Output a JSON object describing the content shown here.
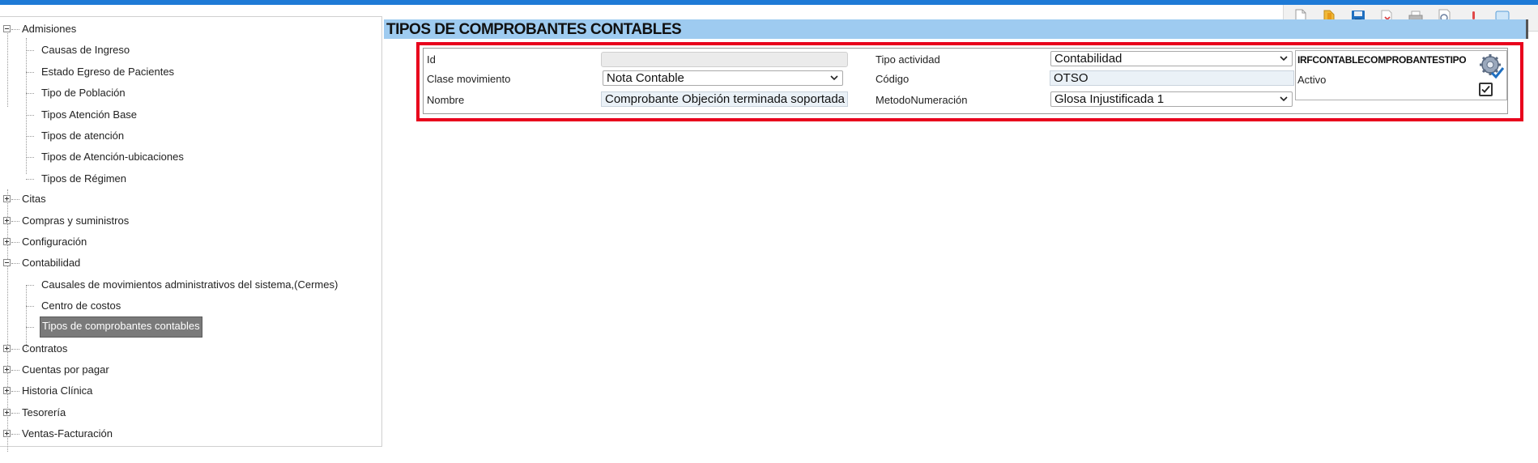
{
  "sidebar": {
    "groups": [
      {
        "label": "Admisiones",
        "expanded": true,
        "children": [
          "Causas de Ingreso",
          "Estado Egreso de Pacientes",
          "Tipo de Población",
          "Tipos Atención Base",
          "Tipos de atención",
          "Tipos de Atención-ubicaciones",
          "Tipos de Régimen"
        ]
      },
      {
        "label": "Citas",
        "expanded": false
      },
      {
        "label": "Compras y suministros",
        "expanded": false
      },
      {
        "label": "Configuración",
        "expanded": false
      },
      {
        "label": "Contabilidad",
        "expanded": true,
        "children": [
          "Causales de movimientos administrativos del sistema,(Cermes)",
          "Centro de costos",
          "Tipos de comprobantes contables"
        ],
        "selected": "Tipos de comprobantes contables"
      },
      {
        "label": "Contratos",
        "expanded": false
      },
      {
        "label": "Cuentas por pagar",
        "expanded": false
      },
      {
        "label": "Historia Clínica",
        "expanded": false
      },
      {
        "label": "Tesorería",
        "expanded": false
      },
      {
        "label": "Ventas-Facturación",
        "expanded": false
      }
    ]
  },
  "toolbar": {
    "buttons": [
      "new-document-icon",
      "open-folder-icon",
      "save-icon",
      "delete-icon",
      "print-icon",
      "print-preview-icon",
      "alert-icon",
      "comment-icon"
    ]
  },
  "page": {
    "title": "TIPOS DE COMPROBANTES CONTABLES"
  },
  "form": {
    "id": {
      "label": "Id",
      "value": ""
    },
    "clase_movimiento": {
      "label": "Clase movimiento",
      "value": "Nota Contable"
    },
    "nombre": {
      "label": "Nombre",
      "value": "Comprobante Objeción terminada soportada"
    },
    "tipo_actividad": {
      "label": "Tipo actividad",
      "value": "Contabilidad"
    },
    "codigo": {
      "label": "Código",
      "value": "OTSO"
    },
    "metodo_numeracion": {
      "label": "MetodoNumeración",
      "value": "Glosa Injustificada 1"
    },
    "component_name": "IRFCONTABLECOMPROBANTESTIPO",
    "activo": {
      "label": "Activo",
      "checked": true
    }
  },
  "colors": {
    "accent": "#1e7ad6",
    "title_bar": "#9ecbf0",
    "highlight": "#e8001c",
    "selected": "#7a7a7a"
  }
}
